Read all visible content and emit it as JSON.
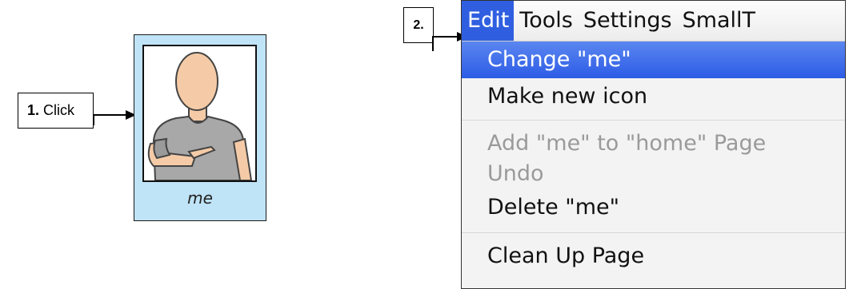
{
  "step1": {
    "number": "1.",
    "action": "Click"
  },
  "step2": {
    "number": "2."
  },
  "card": {
    "label": "me",
    "background": "#bfe3f7"
  },
  "menubar": {
    "items": [
      {
        "label": "Edit",
        "active": true
      },
      {
        "label": "Tools"
      },
      {
        "label": "Settings"
      },
      {
        "label": "SmallT"
      }
    ]
  },
  "menu": {
    "items": [
      {
        "label": "Change \"me\"",
        "state": "highlighted"
      },
      {
        "label": "Make new icon",
        "state": "enabled"
      },
      {
        "label": "Add \"me\" to \"home\" Page",
        "state": "disabled"
      },
      {
        "label": "Undo",
        "state": "disabled"
      },
      {
        "label": "Delete \"me\"",
        "state": "enabled"
      },
      {
        "label": "Clean Up Page",
        "state": "enabled"
      }
    ]
  },
  "colors": {
    "menu_highlight": "#2f5fe0",
    "disabled_text": "#9a9a9a"
  }
}
